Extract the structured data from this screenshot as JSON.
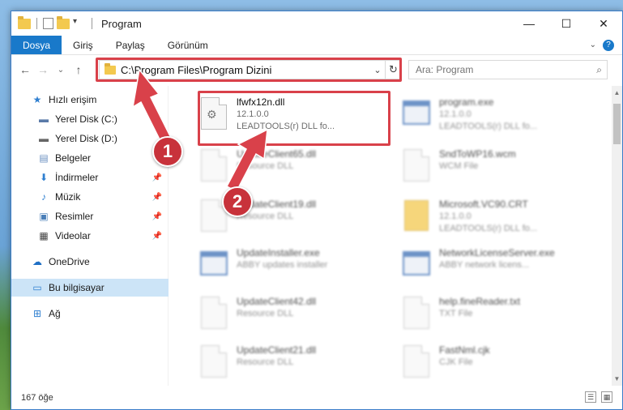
{
  "window": {
    "title": "Program",
    "controls": {
      "minimize": "—",
      "maximize": "☐",
      "close": "✕"
    }
  },
  "ribbon": {
    "tabs": [
      {
        "label": "Dosya",
        "active": true
      },
      {
        "label": "Giriş"
      },
      {
        "label": "Paylaş"
      },
      {
        "label": "Görünüm"
      }
    ]
  },
  "nav": {
    "address": "C:\\Program Files\\Program Dizini",
    "search_placeholder": "Ara: Program"
  },
  "sidebar": {
    "items": [
      {
        "label": "Hızlı erişim",
        "icon": "star-icon"
      },
      {
        "label": "Yerel Disk (C:)",
        "icon": "drive-icon"
      },
      {
        "label": "Yerel Disk (D:)",
        "icon": "drive-icon"
      },
      {
        "label": "Belgeler",
        "icon": "documents-icon"
      },
      {
        "label": "İndirmeler",
        "icon": "download-icon"
      },
      {
        "label": "Müzik",
        "icon": "music-icon"
      },
      {
        "label": "Resimler",
        "icon": "pictures-icon"
      },
      {
        "label": "Videolar",
        "icon": "video-icon"
      },
      {
        "label": "OneDrive",
        "icon": "cloud-icon"
      },
      {
        "label": "Bu bilgisayar",
        "icon": "computer-icon"
      },
      {
        "label": "Ağ",
        "icon": "network-icon"
      }
    ]
  },
  "files": [
    {
      "name": "lfwfx12n.dll",
      "line1": "12.1.0.0",
      "line2": "LEADTOOLS(r) DLL fo...",
      "icon": "dll"
    },
    {
      "name": "program.exe",
      "line1": "12.1.0.0",
      "line2": "LEADTOOLS(r) DLL fo...",
      "icon": "app"
    },
    {
      "name": "UpdateClient65.dll",
      "line1": "Resource DLL",
      "line2": "",
      "icon": "dll"
    },
    {
      "name": "SndToWP16.wcm",
      "line1": "WCM File",
      "line2": "",
      "icon": "doc"
    },
    {
      "name": "UpdateClient19.dll",
      "line1": "Resource DLL",
      "line2": "",
      "icon": "dll"
    },
    {
      "name": "Microsoft.VC90.CRT",
      "line1": "12.1.0.0",
      "line2": "LEADTOOLS(r) DLL fo...",
      "icon": "folderdoc"
    },
    {
      "name": "UpdateInstaller.exe",
      "line1": "ABBY updates installer",
      "line2": "",
      "icon": "app"
    },
    {
      "name": "NetworkLicenseServer.exe",
      "line1": "ABBY network licens...",
      "line2": "",
      "icon": "app"
    },
    {
      "name": "UpdateClient42.dll",
      "line1": "Resource DLL",
      "line2": "",
      "icon": "dll"
    },
    {
      "name": "help.fineReader.txt",
      "line1": "TXT File",
      "line2": "",
      "icon": "doc"
    },
    {
      "name": "UpdateClient21.dll",
      "line1": "Resource DLL",
      "line2": "",
      "icon": "dll"
    },
    {
      "name": "FastNml.cjk",
      "line1": "CJK File",
      "line2": "",
      "icon": "doc"
    }
  ],
  "status": {
    "count": "167 öğe"
  },
  "callouts": {
    "one": "1",
    "two": "2"
  },
  "colors": {
    "accent": "#1979ca",
    "highlight": "#d9414a",
    "badge": "#c8323b"
  }
}
